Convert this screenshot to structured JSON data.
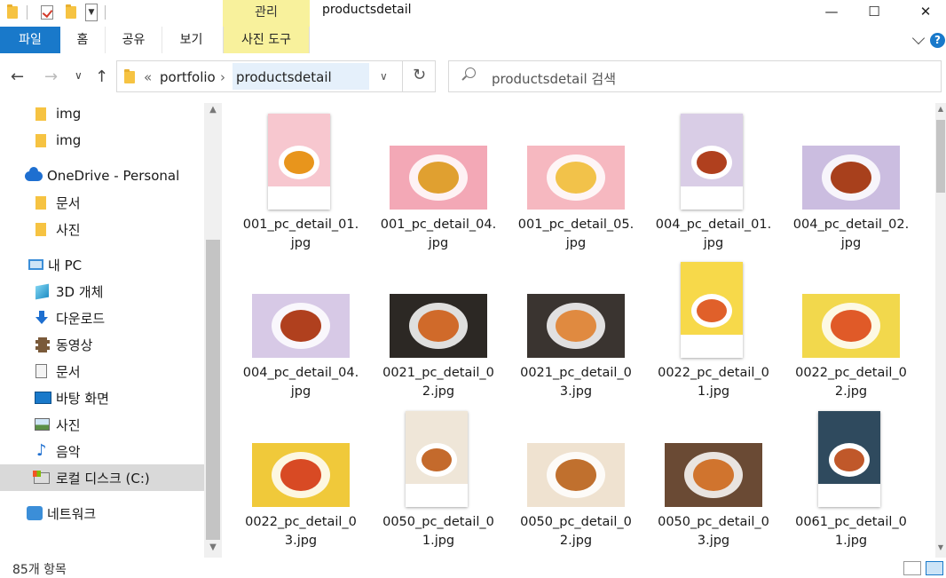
{
  "window": {
    "title": "productsdetail",
    "context_tab_group": "관리",
    "controls": {
      "minimize": "—",
      "maximize": "☐",
      "close": "✕"
    }
  },
  "ribbon": {
    "tabs": [
      "파일",
      "홈",
      "공유",
      "보기",
      "사진 도구"
    ],
    "help": "?"
  },
  "address": {
    "overflow": "«",
    "segments": [
      "portfolio",
      "productsdetail"
    ],
    "separator": "›",
    "search_placeholder": "productsdetail 검색"
  },
  "sidebar": {
    "items": [
      {
        "label": "img",
        "icon": "folder-icon"
      },
      {
        "label": "img",
        "icon": "folder-icon"
      },
      {
        "label": "OneDrive - Personal",
        "icon": "onedrive-cloud-icon"
      },
      {
        "label": "문서",
        "icon": "folder-icon"
      },
      {
        "label": "사진",
        "icon": "folder-icon"
      },
      {
        "label": "내 PC",
        "icon": "pc-icon"
      },
      {
        "label": "3D 개체",
        "icon": "3d-objects-icon"
      },
      {
        "label": "다운로드",
        "icon": "download-icon"
      },
      {
        "label": "동영상",
        "icon": "video-icon"
      },
      {
        "label": "문서",
        "icon": "document-icon"
      },
      {
        "label": "바탕 화면",
        "icon": "desktop-icon"
      },
      {
        "label": "사진",
        "icon": "pictures-icon"
      },
      {
        "label": "음악",
        "icon": "music-icon"
      },
      {
        "label": "로컬 디스크 (C:)",
        "icon": "local-disk-icon",
        "selected": true
      },
      {
        "label": "네트워크",
        "icon": "network-icon"
      }
    ]
  },
  "files": [
    {
      "line1": "001_pc_detail_01.",
      "line2": "jpg",
      "kind": "poster",
      "bg": "#f7c7cf",
      "accent": "#e8951c"
    },
    {
      "line1": "001_pc_detail_04.",
      "line2": "jpg",
      "kind": "photo",
      "bg": "#f3a8b6",
      "accent": "#e0a030"
    },
    {
      "line1": "001_pc_detail_05.",
      "line2": "jpg",
      "kind": "photo",
      "bg": "#f6b8c0",
      "accent": "#f2c24a"
    },
    {
      "line1": "004_pc_detail_01.",
      "line2": "jpg",
      "kind": "poster",
      "bg": "#d9cde6",
      "accent": "#b0401e"
    },
    {
      "line1": "004_pc_detail_02.",
      "line2": "jpg",
      "kind": "photo",
      "bg": "#cbbde0",
      "accent": "#a8401c"
    },
    {
      "line1": "004_pc_detail_04.",
      "line2": "jpg",
      "kind": "photo",
      "bg": "#d7c9e6",
      "accent": "#b0401e"
    },
    {
      "line1": "0021_pc_detail_0",
      "line2": "2.jpg",
      "kind": "photo",
      "bg": "#2c2824",
      "accent": "#d06a2a"
    },
    {
      "line1": "0021_pc_detail_0",
      "line2": "3.jpg",
      "kind": "photo",
      "bg": "#3a3430",
      "accent": "#e08a40"
    },
    {
      "line1": "0022_pc_detail_0",
      "line2": "1.jpg",
      "kind": "poster",
      "bg": "#f7d94a",
      "accent": "#e0602a"
    },
    {
      "line1": "0022_pc_detail_0",
      "line2": "2.jpg",
      "kind": "photo",
      "bg": "#f2d84c",
      "accent": "#e05a28"
    },
    {
      "line1": "0022_pc_detail_0",
      "line2": "3.jpg",
      "kind": "photo",
      "bg": "#f0c93a",
      "accent": "#d84a24"
    },
    {
      "line1": "0050_pc_detail_0",
      "line2": "1.jpg",
      "kind": "poster",
      "bg": "#efe6d8",
      "accent": "#c46a2c"
    },
    {
      "line1": "0050_pc_detail_0",
      "line2": "2.jpg",
      "kind": "photo",
      "bg": "#efe2d0",
      "accent": "#c0702e"
    },
    {
      "line1": "0050_pc_detail_0",
      "line2": "3.jpg",
      "kind": "photo",
      "bg": "#6a4a34",
      "accent": "#d0742e"
    },
    {
      "line1": "0061_pc_detail_0",
      "line2": "1.jpg",
      "kind": "poster",
      "bg": "#2f4a5e",
      "accent": "#c0582a"
    }
  ],
  "status": {
    "item_count": "85개 항목"
  }
}
